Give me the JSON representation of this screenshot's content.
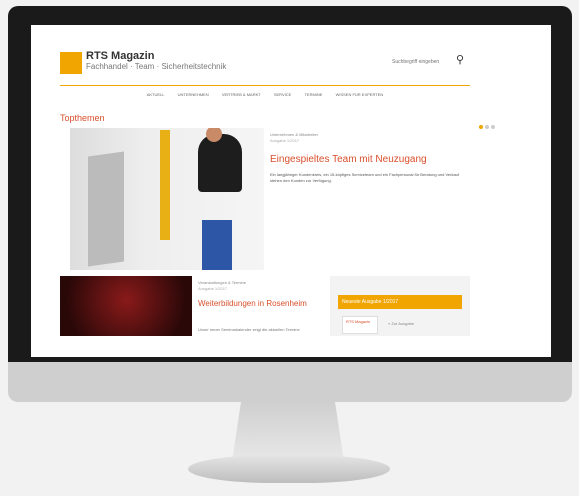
{
  "site": {
    "logo_title": "RTS Magazin",
    "logo_subtitle": "Fachhandel · Team · Sicherheitstechnik",
    "search_placeholder": "Suchbegriff eingeben",
    "nav": [
      "AKTUELL",
      "UNTERNEHMEN",
      "VERTRIEB & MARKT",
      "SERVICE",
      "TERMINE",
      "WISSEN FÜR EXPERTEN"
    ]
  },
  "hero": {
    "section_title": "Topthemen",
    "category": "Unternehmen & Mitarbeiter",
    "date": "Ausgabe 1/2017",
    "title": "Eingespieltes Team mit Neuzugang",
    "text": "Ein langjähriger Kundenkreis, ein 15-köpfiges Serviceteam und ein Fachpersonal für Beratung und Verkauf stehen den Kunden zur Verfügung."
  },
  "card": {
    "category": "Veranstaltungen & Termine",
    "date": "Ausgabe 1/2017",
    "title": "Weiterbildungen in Rosenheim",
    "text": "Unser neuer Seminarkalender zeigt die aktuellen Termine"
  },
  "sidebar": {
    "banner": "Neueste Ausgabe 1/2017",
    "thumb_label": "RTS Magazin",
    "link": "» Zur Ausgabe"
  },
  "colors": {
    "accent": "#f0a500",
    "headline": "#d94f2b"
  }
}
